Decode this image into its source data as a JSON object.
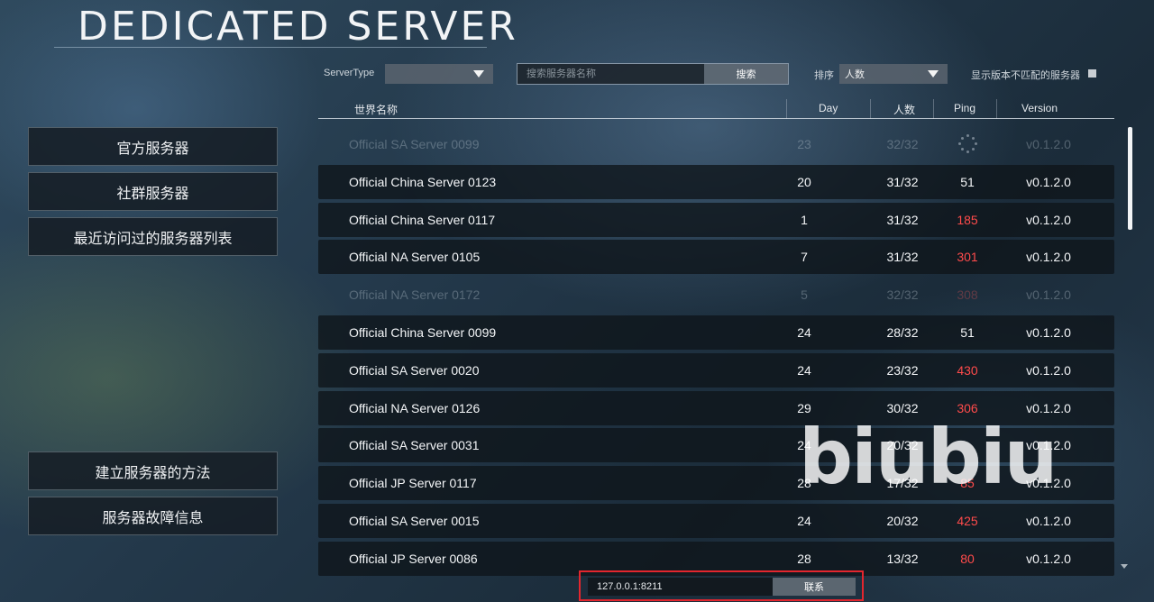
{
  "title": "DEDICATED SERVER",
  "nav": {
    "official": "官方服务器",
    "community": "社群服务器",
    "recent": "最近访问过的服务器列表",
    "how_to": "建立服务器的方法",
    "issues": "服务器故障信息"
  },
  "filters": {
    "server_type_label": "ServerType",
    "server_type_value": "",
    "search_placeholder": "搜索服务器名称",
    "search_button": "搜索",
    "sort_label": "排序",
    "sort_value": "人数",
    "show_mismatch_label": "显示版本不匹配的服务器"
  },
  "table": {
    "headers": {
      "name": "世界名称",
      "day": "Day",
      "players": "人数",
      "ping": "Ping",
      "version": "Version"
    },
    "rows": [
      {
        "name": "Official SA Server 0099",
        "day": "23",
        "players": "32/32",
        "ping": "",
        "ping_bad": false,
        "version": "v0.1.2.0",
        "faded": true,
        "loading": true
      },
      {
        "name": "Official China Server 0123",
        "day": "20",
        "players": "31/32",
        "ping": "51",
        "ping_bad": false,
        "version": "v0.1.2.0",
        "faded": false
      },
      {
        "name": "Official China Server 0117",
        "day": "1",
        "players": "31/32",
        "ping": "185",
        "ping_bad": true,
        "version": "v0.1.2.0",
        "faded": false
      },
      {
        "name": "Official NA Server 0105",
        "day": "7",
        "players": "31/32",
        "ping": "301",
        "ping_bad": true,
        "version": "v0.1.2.0",
        "faded": false
      },
      {
        "name": "Official NA Server 0172",
        "day": "5",
        "players": "32/32",
        "ping": "308",
        "ping_bad": true,
        "version": "v0.1.2.0",
        "faded": true
      },
      {
        "name": "Official China Server 0099",
        "day": "24",
        "players": "28/32",
        "ping": "51",
        "ping_bad": false,
        "version": "v0.1.2.0",
        "faded": false
      },
      {
        "name": "Official SA Server 0020",
        "day": "24",
        "players": "23/32",
        "ping": "430",
        "ping_bad": true,
        "version": "v0.1.2.0",
        "faded": false
      },
      {
        "name": "Official NA Server 0126",
        "day": "29",
        "players": "30/32",
        "ping": "306",
        "ping_bad": true,
        "version": "v0.1.2.0",
        "faded": false
      },
      {
        "name": "Official SA Server 0031",
        "day": "24",
        "players": "20/32",
        "ping": "",
        "ping_bad": false,
        "version": "v0.1.2.0",
        "faded": false
      },
      {
        "name": "Official JP Server 0117",
        "day": "28",
        "players": "17/32",
        "ping": "85",
        "ping_bad": true,
        "version": "v0.1.2.0",
        "faded": false
      },
      {
        "name": "Official SA Server 0015",
        "day": "24",
        "players": "20/32",
        "ping": "425",
        "ping_bad": true,
        "version": "v0.1.2.0",
        "faded": false
      },
      {
        "name": "Official JP Server 0086",
        "day": "28",
        "players": "13/32",
        "ping": "80",
        "ping_bad": true,
        "version": "v0.1.2.0",
        "faded": false
      }
    ]
  },
  "connect": {
    "address": "127.0.0.1:8211",
    "button": "联系"
  },
  "watermark": "biubiu"
}
